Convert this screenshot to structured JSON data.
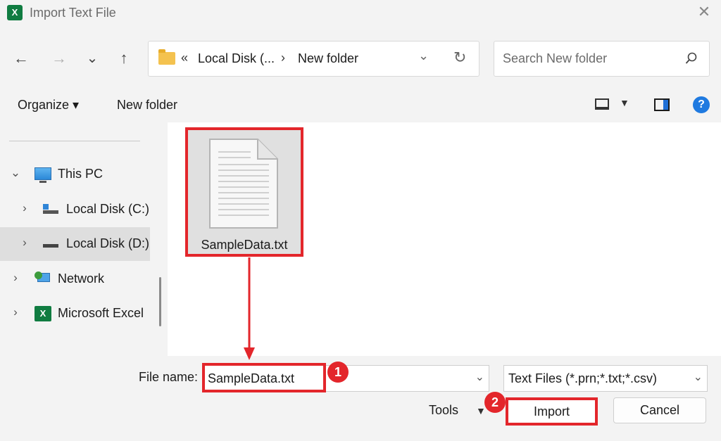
{
  "window": {
    "title": "Import Text File",
    "app_icon": "excel-icon",
    "close": "✕"
  },
  "nav": {
    "back": "←",
    "forward": "→",
    "recent": "⌄",
    "up": "↑"
  },
  "address": {
    "overflow": "«",
    "crumbs": [
      "Local Disk (...",
      "New folder"
    ],
    "separator": "›",
    "dropdown": "⌄",
    "refresh": "↻"
  },
  "search": {
    "placeholder": "Search New folder"
  },
  "toolbar": {
    "organize": "Organize ▾",
    "new_folder": "New folder",
    "view_drop": "▼",
    "help": "?"
  },
  "sidebar": {
    "items": [
      {
        "label": "This PC",
        "chevron": "⌄",
        "icon": "computer-icon"
      },
      {
        "label": "Local Disk (C:)",
        "chevron": "›",
        "icon": "drive-c-icon"
      },
      {
        "label": "Local Disk (D:)",
        "chevron": "›",
        "icon": "drive-d-icon",
        "selected": true
      },
      {
        "label": "Network",
        "chevron": "›",
        "icon": "network-icon"
      },
      {
        "label": "Microsoft Excel",
        "chevron": "›",
        "icon": "excel-icon"
      }
    ]
  },
  "files": [
    {
      "name": "SampleData.txt",
      "icon": "text-document-icon"
    }
  ],
  "footer": {
    "file_name_label": "File name:",
    "file_name_value": "SampleData.txt",
    "file_type": "Text Files (*.prn;*.txt;*.csv)",
    "dropdown": "⌄",
    "tools": "Tools",
    "tools_drop": "▼",
    "import": "Import",
    "cancel": "Cancel"
  },
  "annotations": {
    "step1": "1",
    "step2": "2",
    "highlight_color": "#e3262b"
  },
  "colors": {
    "accent": "#1f7ae0",
    "excel": "#107c41"
  }
}
